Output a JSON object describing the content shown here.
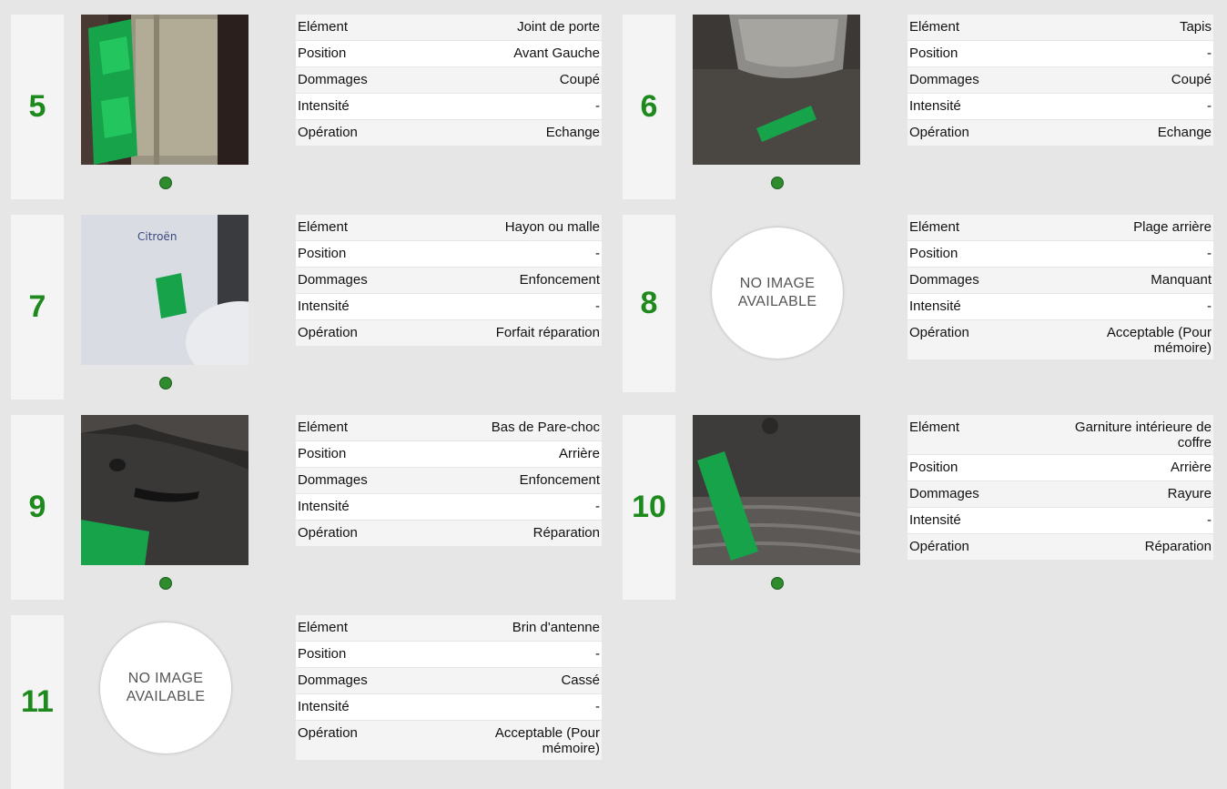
{
  "labels": {
    "element": "Elément",
    "position": "Position",
    "damages": "Dommages",
    "intensity": "Intensité",
    "operation": "Opération"
  },
  "no_image_text": "NO IMAGE AVAILABLE",
  "status_color": "#2e8b2e",
  "number_color": "#1e8a1e",
  "cards": [
    {
      "number": "5",
      "element": "Joint de porte",
      "position": "Avant Gauche",
      "damages": "Coupé",
      "intensity": "-",
      "operation": "Echange",
      "has_photo": true,
      "photo_icon": "dekra-door-seal-photo"
    },
    {
      "number": "6",
      "element": "Tapis",
      "position": "-",
      "damages": "Coupé",
      "intensity": "-",
      "operation": "Echange",
      "has_photo": true,
      "photo_icon": "dekra-floor-mat-photo"
    },
    {
      "number": "7",
      "element": "Hayon ou malle",
      "position": "-",
      "damages": "Enfoncement",
      "intensity": "-",
      "operation": "Forfait réparation",
      "has_photo": true,
      "photo_icon": "dekra-tailgate-photo"
    },
    {
      "number": "8",
      "element": "Plage arrière",
      "position": "-",
      "damages": "Manquant",
      "intensity": "-",
      "operation": "Acceptable (Pour mémoire)",
      "has_photo": false
    },
    {
      "number": "9",
      "element": "Bas de Pare-choc",
      "position": "Arrière",
      "damages": "Enfoncement",
      "intensity": "-",
      "operation": "Réparation",
      "has_photo": true,
      "photo_icon": "dekra-bumper-photo"
    },
    {
      "number": "10",
      "element": "Garniture intérieure de coffre",
      "position": "Arrière",
      "damages": "Rayure",
      "intensity": "-",
      "operation": "Réparation",
      "has_photo": true,
      "photo_icon": "dekra-trunk-trim-photo"
    },
    {
      "number": "11",
      "element": "Brin d'antenne",
      "position": "-",
      "damages": "Cassé",
      "intensity": "-",
      "operation": "Acceptable (Pour mémoire)",
      "has_photo": false
    }
  ]
}
